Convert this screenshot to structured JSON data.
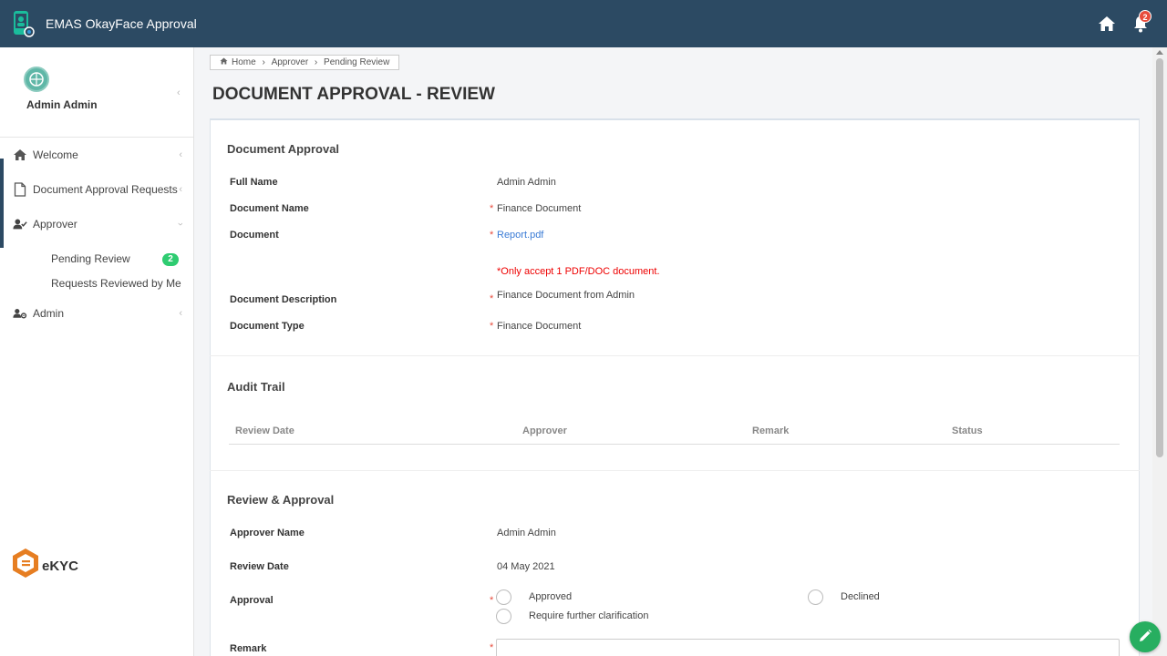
{
  "header": {
    "app_title": "EMAS OkayFace Approval",
    "notification_count": "2"
  },
  "sidebar": {
    "user_name": "Admin Admin",
    "items": [
      {
        "label": "Welcome",
        "icon": "home-icon"
      },
      {
        "label": "Document Approval Requests",
        "icon": "document-icon"
      },
      {
        "label": "Approver",
        "icon": "user-check-icon"
      },
      {
        "label": "Admin",
        "icon": "user-gear-icon"
      }
    ],
    "sub_items": [
      {
        "label": "Pending Review",
        "badge": "2"
      },
      {
        "label": "Requests Reviewed by Me"
      }
    ],
    "logo_text": "eKYC"
  },
  "breadcrumb": {
    "items": [
      "Home",
      "Approver",
      "Pending Review"
    ]
  },
  "page_title": "DOCUMENT APPROVAL - REVIEW",
  "document_approval": {
    "section_title": "Document Approval",
    "full_name_label": "Full Name",
    "full_name_value": "Admin Admin",
    "doc_name_label": "Document Name",
    "doc_name_value": "Finance Document",
    "document_label": "Document",
    "document_value": "Report.pdf",
    "document_hint": "*Only accept 1 PDF/DOC document.",
    "description_label": "Document Description",
    "description_value": "Finance Document from Admin",
    "type_label": "Document Type",
    "type_value": "Finance Document"
  },
  "audit_trail": {
    "section_title": "Audit Trail",
    "columns": [
      "Review Date",
      "Approver",
      "Remark",
      "Status"
    ]
  },
  "review": {
    "section_title": "Review & Approval",
    "approver_label": "Approver Name",
    "approver_value": "Admin Admin",
    "date_label": "Review Date",
    "date_value": "04 May 2021",
    "approval_label": "Approval",
    "options": [
      "Approved",
      "Declined",
      "Require further clarification"
    ],
    "remark_label": "Remark"
  },
  "colors": {
    "header_bg": "#2c4a63",
    "required": "#e74c3c",
    "badge": "#2ecc71",
    "link": "#3a7bd5"
  }
}
